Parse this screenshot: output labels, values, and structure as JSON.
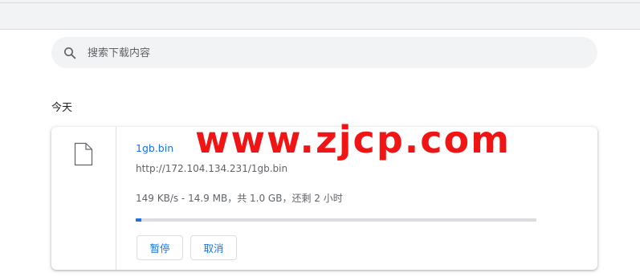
{
  "search": {
    "placeholder": "搜索下载内容"
  },
  "section": {
    "title": "今天"
  },
  "download": {
    "file_name": "1gb.bin",
    "url": "http://172.104.134.231/1gb.bin",
    "status": "149 KB/s - 14.9 MB，共 1.0 GB，还剩 2 小时",
    "progress_fraction": 0.0149
  },
  "actions": {
    "pause_label": "暂停",
    "cancel_label": "取消"
  },
  "watermark": {
    "text": "www.zjcp.com"
  },
  "colors": {
    "accent": "#1a73e8",
    "watermark": "#f01414",
    "text_secondary": "#5f6368",
    "surface": "#f1f3f4"
  },
  "icons": {
    "search": "search-icon",
    "file": "file-icon"
  }
}
